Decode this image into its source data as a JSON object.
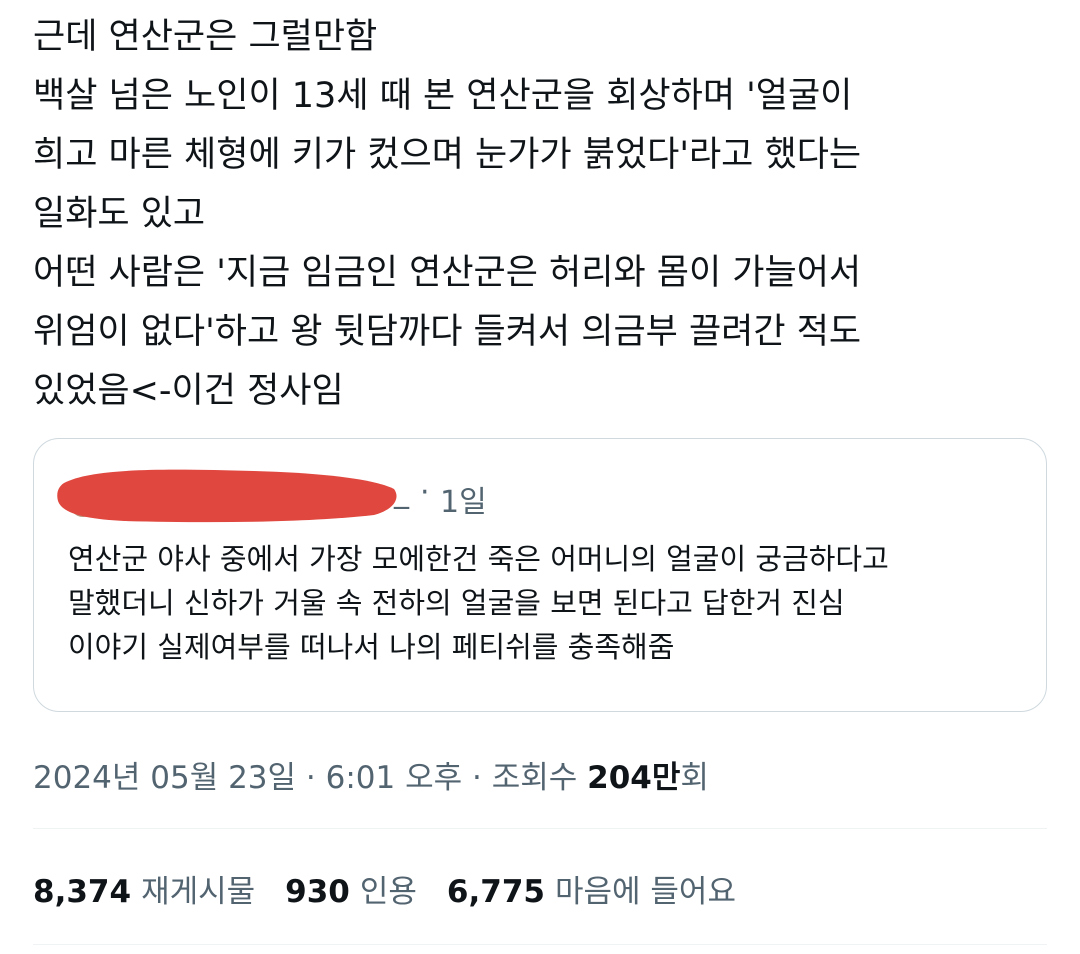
{
  "tweet": {
    "lines": [
      "근데 연산군은 그럴만함",
      "백살 넘은 노인이 13세 때 본 연산군을 회상하며 '얼굴이",
      "희고 마른 체형에 키가 컸으며 눈가가 붉었다'라고 했다는",
      "일화도 있고",
      "어떤 사람은 '지금 임금인 연산군은 허리와 몸이 가늘어서",
      "위엄이 없다'하고 왕 뒷담까다 들켜서 의금부 끌려간 적도",
      "있었음<-이건 정사임"
    ]
  },
  "quote": {
    "handle_tail": "_",
    "separator": "·",
    "time": "1일",
    "lines": [
      "연산군 야사 중에서 가장 모에한건 죽은 어머니의 얼굴이 궁금하다고",
      "말했더니 신하가 거울 속 전하의 얼굴을 보면 된다고 답한거 진심",
      "이야기 실제여부를 떠나서 나의 페티쉬를 충족해줌"
    ],
    "redaction_color": "#e0483f"
  },
  "meta": {
    "date": "2024년 05월 23일",
    "sep1": " · ",
    "time": "6:01 오후",
    "sep2": " · ",
    "views_label": "조회수 ",
    "views_number": "204만",
    "views_suffix": "회"
  },
  "stats": {
    "reposts_count": "8,374",
    "reposts_label": "재게시물",
    "quotes_count": "930",
    "quotes_label": "인용",
    "likes_count": "6,775",
    "likes_label": "마음에 들어요"
  },
  "colors": {
    "text_primary": "#0f1419",
    "text_secondary": "#536471",
    "border": "#cfd9de",
    "divider": "#eff3f4"
  }
}
